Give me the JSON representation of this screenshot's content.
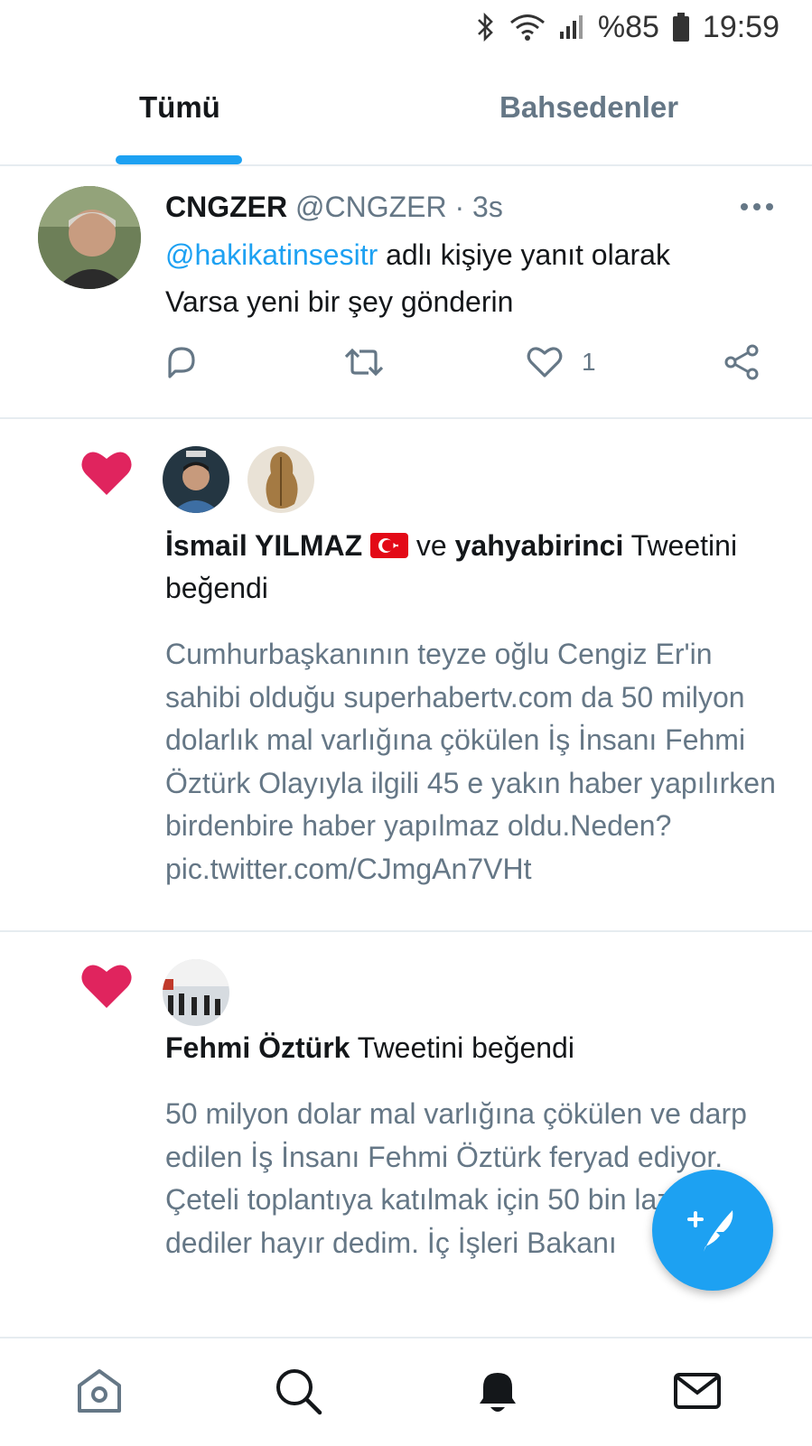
{
  "status": {
    "battery": "%85",
    "time": "19:59"
  },
  "tabs": [
    {
      "label": "Tümü",
      "active": true
    },
    {
      "label": "Bahsedenler",
      "active": false
    }
  ],
  "tweet": {
    "name": "CNGZER",
    "handle": "@CNGZER",
    "separator": "·",
    "time": "3s",
    "reply_mention": "@hakikatinsesitr",
    "reply_suffix": "adlı kişiye yanıt olarak",
    "text": "Varsa yeni bir şey gönderin",
    "like_count": "1"
  },
  "notifications": [
    {
      "users": [
        "İsmail YILMAZ",
        "yahyabirinci"
      ],
      "connector": "ve",
      "action": "Tweetini beğendi",
      "body": "Cumhurbaşkanının teyze oğlu Cengiz Er'in sahibi olduğu superhabertv.com da 50 milyon dolarlık mal varlığına çökülen İş İnsanı Fehmi Öztürk Olayıyla ilgili 45 e yakın haber yapılırken birdenbire haber yapılmaz oldu.Neden? pic.twitter.com/CJmgAn7VHt"
    },
    {
      "users": [
        "Fehmi Öztürk"
      ],
      "action": "Tweetini beğendi",
      "body_line1": "50 milyon dolar mal varlığına çökülen ve darp edilen İş İnsanı Fehmi Öztürk feryad ediyor.",
      "body_line2": "Çeteli toplantıya katılmak için 50 bin lazım dediler hayır dedim. İç İşleri Bakanı"
    }
  ],
  "colors": {
    "accent": "#1da1f2",
    "like": "#e0245e",
    "secondary_text": "#657786"
  },
  "icons": {
    "fab": "compose-tweet-icon",
    "nav": [
      "home-icon",
      "search-icon",
      "notifications-bell-icon",
      "messages-envelope-icon"
    ]
  }
}
